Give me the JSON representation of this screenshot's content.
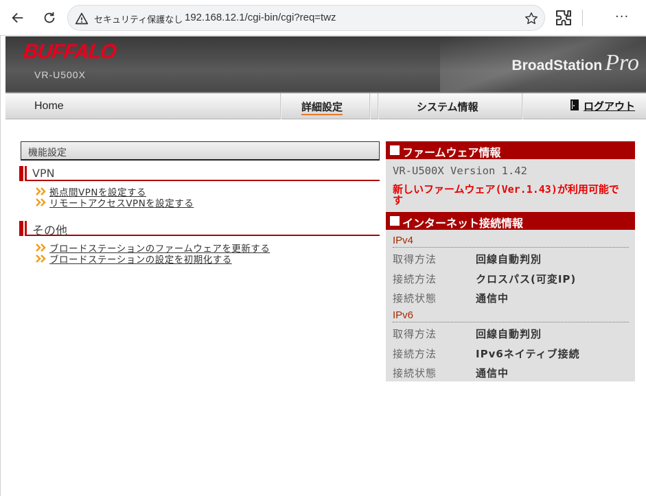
{
  "browser": {
    "security_label": "セキュリティ保護なし",
    "url": "192.168.12.1/cgi-bin/cgi?req=twz",
    "menu": "···"
  },
  "header": {
    "brand": "BUFFALO",
    "model": "VR-U500X",
    "product_main": "BroadStation",
    "product_sub": "Pro"
  },
  "topnav": {
    "home": "Home",
    "advanced": "詳細設定",
    "system_info": "システム情報",
    "logout": "ログアウト"
  },
  "left": {
    "title": "機能設定",
    "sections": [
      {
        "label": "VPN",
        "links": [
          "拠点間VPNを設定する",
          "リモートアクセスVPNを設定する"
        ]
      },
      {
        "label": "その他",
        "links": [
          "ブロードステーションのファームウェアを更新する",
          "ブロードステーションの設定を初期化する"
        ]
      }
    ]
  },
  "right": {
    "firmware": {
      "heading": "ファームウェア情報",
      "version": "VR-U500X Version 1.42",
      "update_notice": "新しいファームウェア(Ver.1.43)が利用可能です"
    },
    "internet": {
      "heading": "インターネット接続情報",
      "ipv4": {
        "label": "IPv4",
        "rows": [
          {
            "key": "取得方法",
            "value": "回線自動判別"
          },
          {
            "key": "接続方法",
            "value": "クロスパス(可変IP)"
          },
          {
            "key": "接続状態",
            "value": "通信中"
          }
        ]
      },
      "ipv6": {
        "label": "IPv6",
        "rows": [
          {
            "key": "取得方法",
            "value": "回線自動判別"
          },
          {
            "key": "接続方法",
            "value": "IPv6ネイティブ接続"
          },
          {
            "key": "接続状態",
            "value": "通信中"
          }
        ]
      }
    }
  },
  "colors": {
    "brand_red": "#e8001c",
    "section_red": "#a80000",
    "notice_red": "#e60000",
    "nav_underline": "#e6782e"
  }
}
